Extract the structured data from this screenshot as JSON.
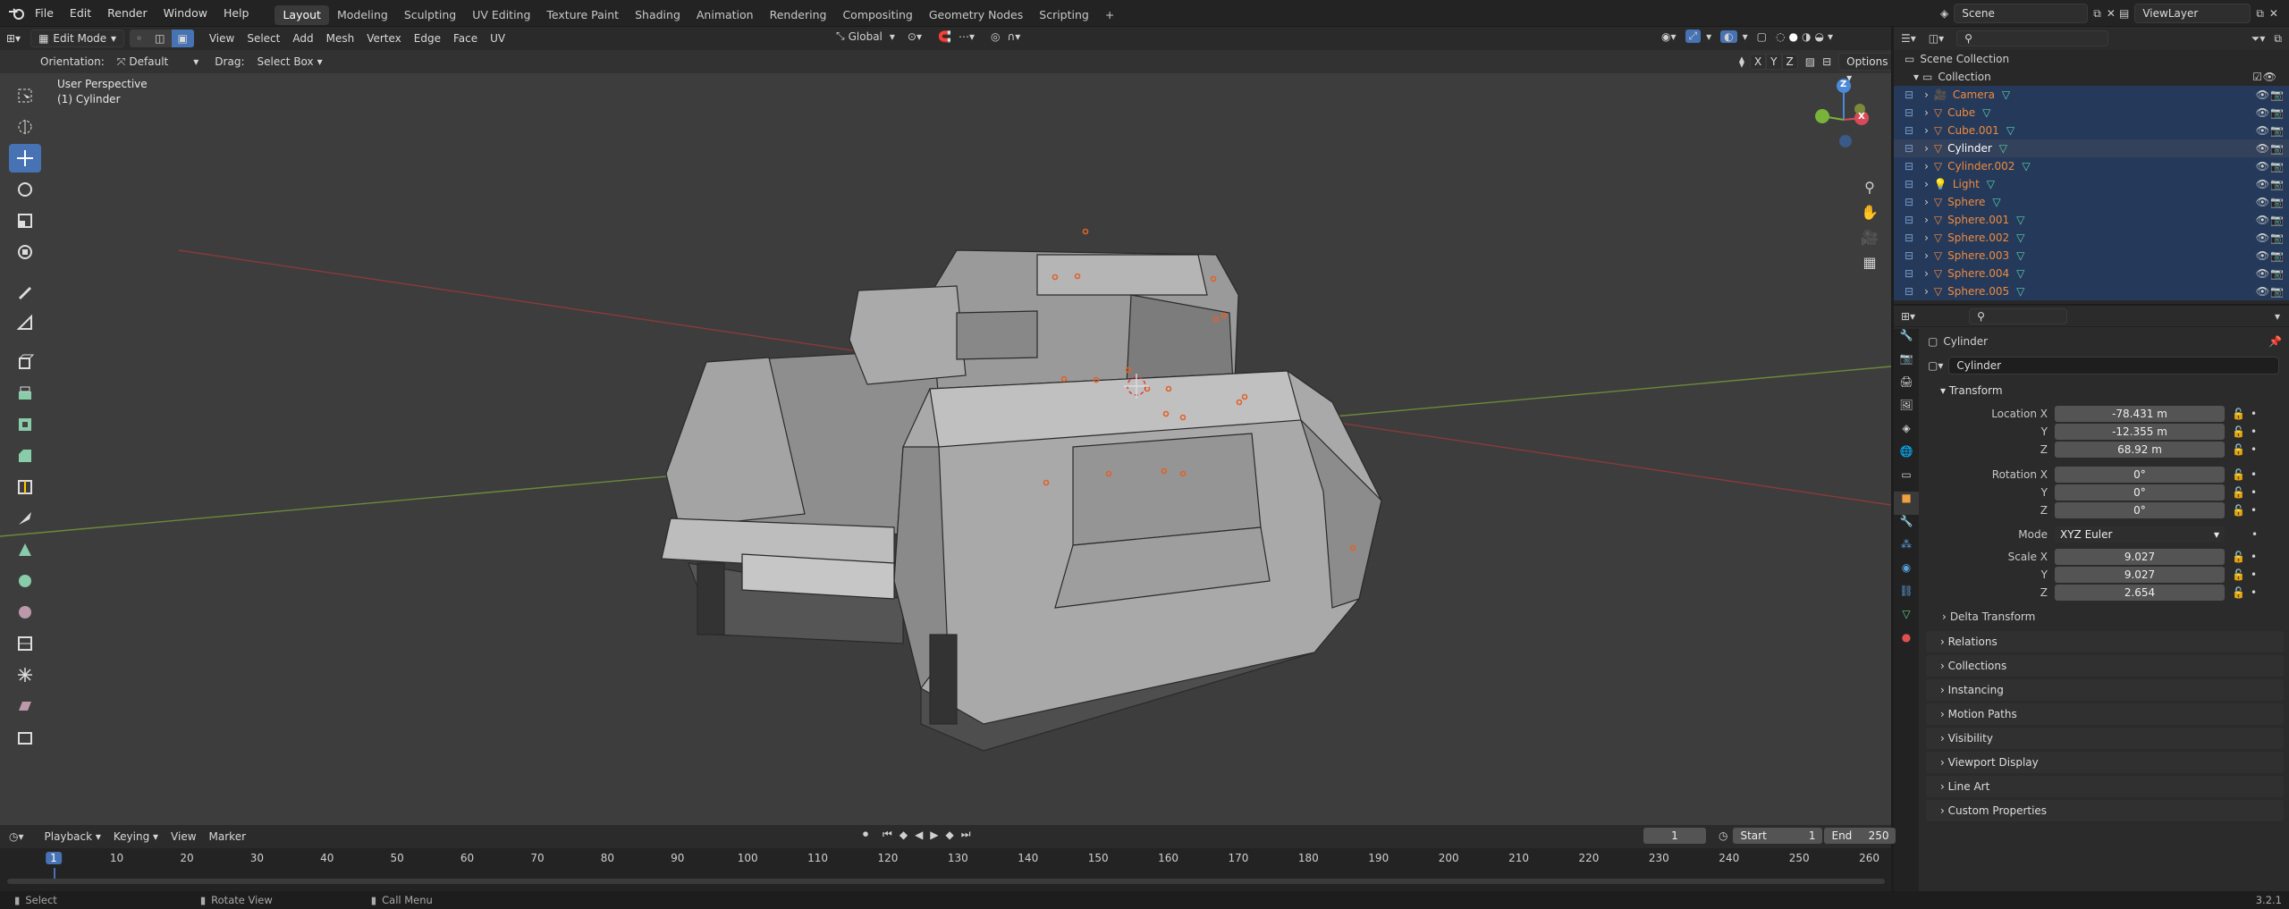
{
  "menubar": {
    "menus": [
      "File",
      "Edit",
      "Render",
      "Window",
      "Help"
    ],
    "workspaces": [
      "Layout",
      "Modeling",
      "Sculpting",
      "UV Editing",
      "Texture Paint",
      "Shading",
      "Animation",
      "Rendering",
      "Compositing",
      "Geometry Nodes",
      "Scripting"
    ],
    "add_tab": "+",
    "scene": "Scene",
    "view_layer": "ViewLayer"
  },
  "viewport": {
    "mode": "Edit Mode",
    "menus": [
      "View",
      "Select",
      "Add",
      "Mesh",
      "Vertex",
      "Edge",
      "Face",
      "UV"
    ],
    "transform_orientation": "Global",
    "orientation_label": "Orientation:",
    "orientation_value": "Default",
    "drag_label": "Drag:",
    "drag_value": "Select Box",
    "axes": [
      "X",
      "Y",
      "Z"
    ],
    "options": "Options",
    "perspective": "User Perspective",
    "object_label": "(1) Cylinder",
    "gizmo": {
      "x": "X",
      "y": "Y",
      "z": "Z"
    }
  },
  "outliner": {
    "root": "Scene Collection",
    "collection": "Collection",
    "items": [
      {
        "name": "Camera",
        "selected": true
      },
      {
        "name": "Cube",
        "selected": true
      },
      {
        "name": "Cube.001",
        "selected": true
      },
      {
        "name": "Cylinder",
        "selected": true,
        "active": true
      },
      {
        "name": "Cylinder.002",
        "selected": true
      },
      {
        "name": "Light",
        "selected": true
      },
      {
        "name": "Sphere",
        "selected": true
      },
      {
        "name": "Sphere.001",
        "selected": true
      },
      {
        "name": "Sphere.002",
        "selected": true
      },
      {
        "name": "Sphere.003",
        "selected": true
      },
      {
        "name": "Sphere.004",
        "selected": true
      },
      {
        "name": "Sphere.005",
        "selected": true
      }
    ]
  },
  "properties": {
    "object_name": "Cylinder",
    "object_field": "Cylinder",
    "transform_header": "Transform",
    "location_label": "Location X",
    "location": {
      "x": "-78.431 m",
      "y": "-12.355 m",
      "z": "68.92 m"
    },
    "rotation_label": "Rotation X",
    "rotation": {
      "x": "0°",
      "y": "0°",
      "z": "0°"
    },
    "mode_label": "Mode",
    "mode_value": "XYZ Euler",
    "scale_label": "Scale X",
    "scale": {
      "x": "9.027",
      "y": "9.027",
      "z": "2.654"
    },
    "axis_y": "Y",
    "axis_z": "Z",
    "delta_transform": "Delta Transform",
    "panels": [
      "Relations",
      "Collections",
      "Instancing",
      "Motion Paths",
      "Visibility",
      "Viewport Display",
      "Line Art",
      "Custom Properties"
    ]
  },
  "timeline": {
    "menus": [
      "Playback",
      "Keying",
      "View",
      "Marker"
    ],
    "current_frame": "1",
    "start_label": "Start",
    "start": "1",
    "end_label": "End",
    "end": "250",
    "ticks": [
      "1",
      "10",
      "20",
      "30",
      "40",
      "50",
      "60",
      "70",
      "80",
      "90",
      "100",
      "110",
      "120",
      "130",
      "140",
      "150",
      "160",
      "170",
      "180",
      "190",
      "200",
      "210",
      "220",
      "230",
      "240",
      "250",
      "260"
    ]
  },
  "statusbar": {
    "select": "Select",
    "rotate": "Rotate View",
    "call_menu": "Call Menu",
    "version": "3.2.1"
  }
}
